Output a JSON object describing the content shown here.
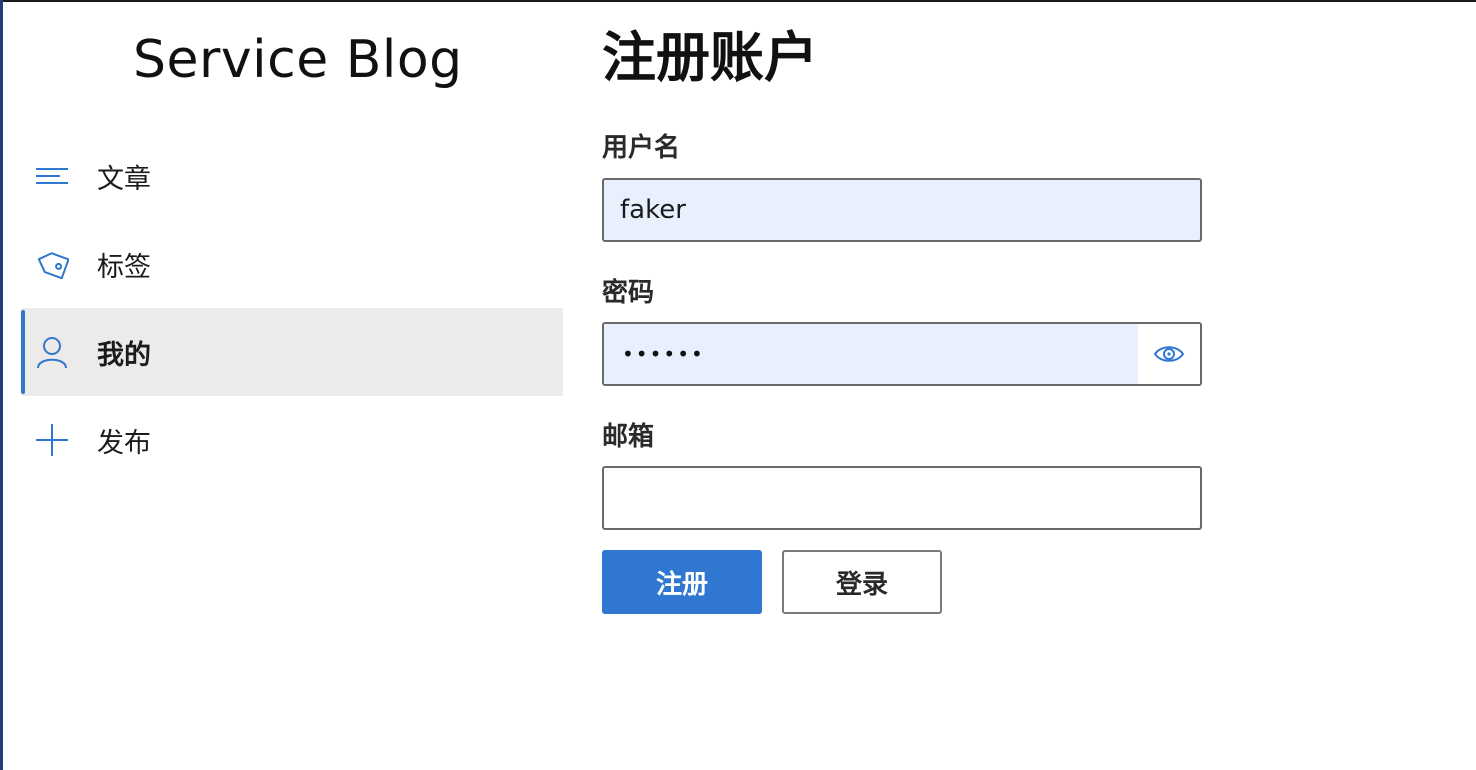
{
  "app": {
    "title": "Service Blog"
  },
  "nav": {
    "items": [
      {
        "label": "文章",
        "icon": "lines-icon",
        "active": false
      },
      {
        "label": "标签",
        "icon": "tag-icon",
        "active": false
      },
      {
        "label": "我的",
        "icon": "person-icon",
        "active": true
      },
      {
        "label": "发布",
        "icon": "plus-icon",
        "active": false
      }
    ]
  },
  "form": {
    "title": "注册账户",
    "username": {
      "label": "用户名",
      "value": "faker"
    },
    "password": {
      "label": "密码",
      "masked_value": "••••••",
      "reveal_icon": "eye-icon"
    },
    "email": {
      "label": "邮箱",
      "value": ""
    },
    "register_label": "注册",
    "login_label": "登录"
  },
  "colors": {
    "accent": "#2f77d0",
    "autofill_bg": "#e8f0fe",
    "active_nav_bg": "#edebe9"
  }
}
